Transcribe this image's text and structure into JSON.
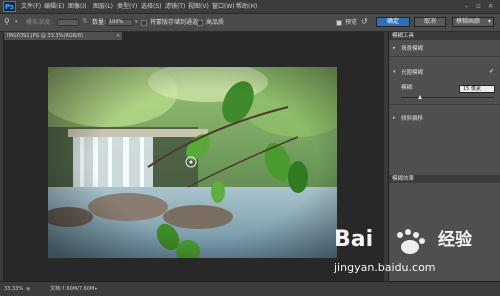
{
  "app": {
    "logo_text": "Ps"
  },
  "menu": [
    "文件(F)",
    "编辑(E)",
    "图像(I)",
    "图层(L)",
    "类型(Y)",
    "选择(S)",
    "滤镜(T)",
    "视图(V)",
    "窗口(W)",
    "帮助(H)"
  ],
  "options": {
    "feather_label": "模拟深度:",
    "amount_label": "数量:",
    "amount_value": "100%",
    "save_mask_label": "将蒙版存储到通道",
    "high_quality_label": "高品质",
    "preview_label": "预览",
    "ok_label": "确定",
    "cancel_label": "取消",
    "gallery_label": "模糊画廊"
  },
  "document": {
    "tab_title": "IMG0392.JPG @ 33.3%(RGB/8)"
  },
  "panels": {
    "blur_tools_title": "模糊工具",
    "field_blur": "场景模糊",
    "iris_blur": "光圈模糊",
    "blur_label": "模糊:",
    "blur_value": "15 像素",
    "blur_slider_fraction": 0.2,
    "tilt_shift": "倾斜偏移",
    "blur_effects_title": "模糊效果"
  },
  "status": {
    "zoom": "33.33%",
    "doc_info": "文档:7.60M/7.60M"
  },
  "watermark": {
    "brand": "Bai",
    "brand2": "du",
    "cn": "经验",
    "url": "jingyan.baidu.com"
  },
  "colors": {
    "accent": "#2f7fd0",
    "panel": "#4f4f4f",
    "workspace": "#282828"
  }
}
